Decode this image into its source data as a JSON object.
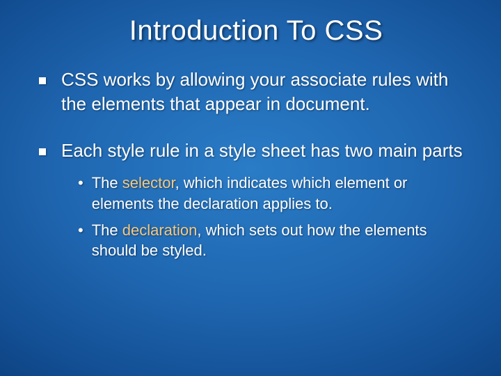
{
  "title": "Introduction To CSS",
  "items": [
    {
      "text": "CSS works by allowing your associate rules with the elements that appear in document."
    },
    {
      "text": "Each style rule in a style sheet has two main parts",
      "sub": [
        {
          "pre": "The ",
          "hl": "selector",
          "post": ", which indicates which element or elements the declaration applies to."
        },
        {
          "pre": "The ",
          "hl": "declaration",
          "post": ", which sets out how the elements should be styled."
        }
      ]
    }
  ]
}
